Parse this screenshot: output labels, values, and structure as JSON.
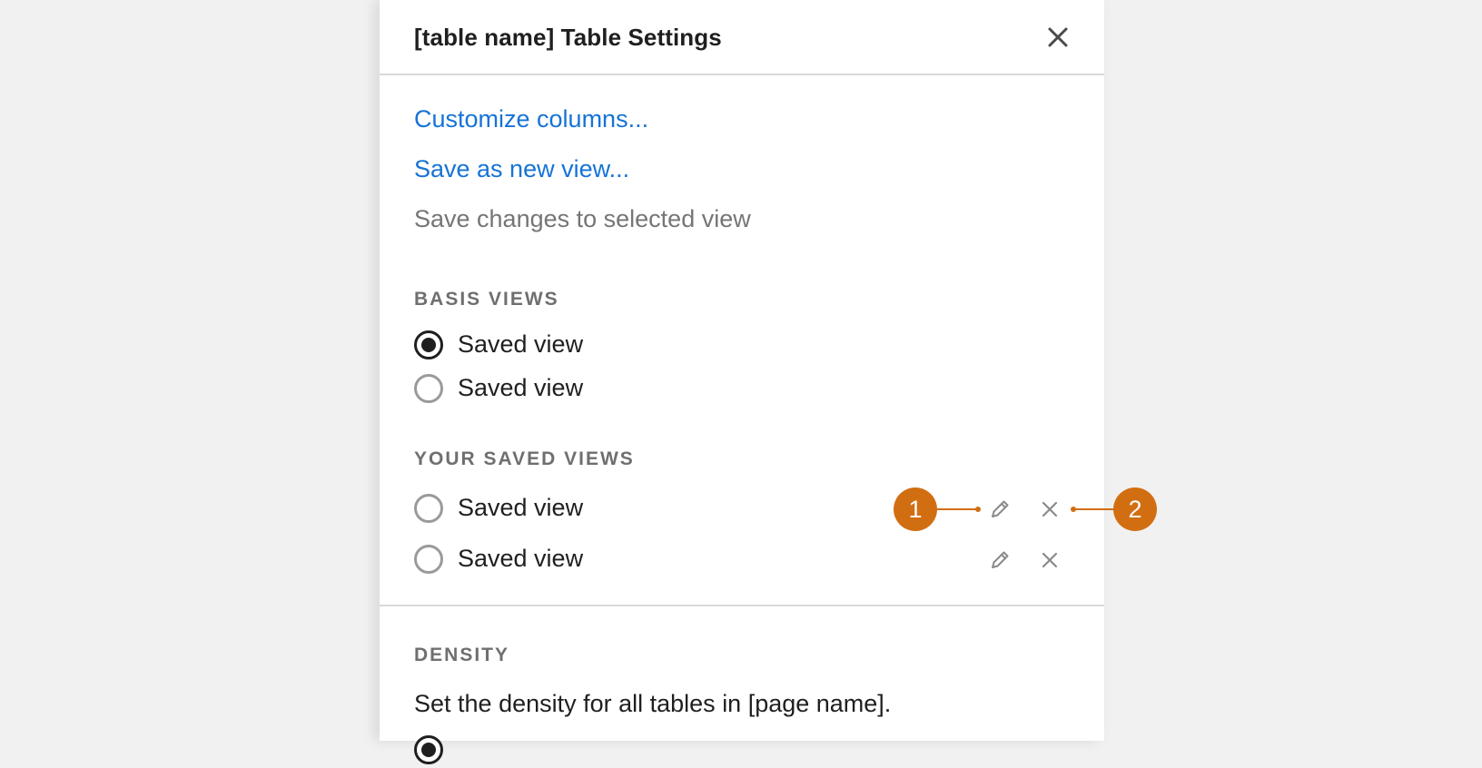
{
  "header": {
    "title": "[table name] Table Settings"
  },
  "actions": {
    "customize": "Customize columns...",
    "save_new": "Save as new view...",
    "save_changes": "Save changes to selected view"
  },
  "basis_views": {
    "label": "BASIS VIEWS",
    "items": [
      {
        "label": "Saved view",
        "selected": true
      },
      {
        "label": "Saved view",
        "selected": false
      }
    ]
  },
  "your_saved_views": {
    "label": "YOUR SAVED VIEWS",
    "items": [
      {
        "label": "Saved view",
        "selected": false
      },
      {
        "label": "Saved view",
        "selected": false
      }
    ]
  },
  "density": {
    "label": "DENSITY",
    "description": "Set the density for all tables in [page name]."
  },
  "callouts": [
    "1",
    "2"
  ],
  "colors": {
    "link": "#1673d6",
    "callout": "#d26e12",
    "text": "#1f1f1f"
  },
  "icons": {
    "close": "close-icon",
    "edit": "pencil-icon",
    "delete": "x-icon"
  }
}
